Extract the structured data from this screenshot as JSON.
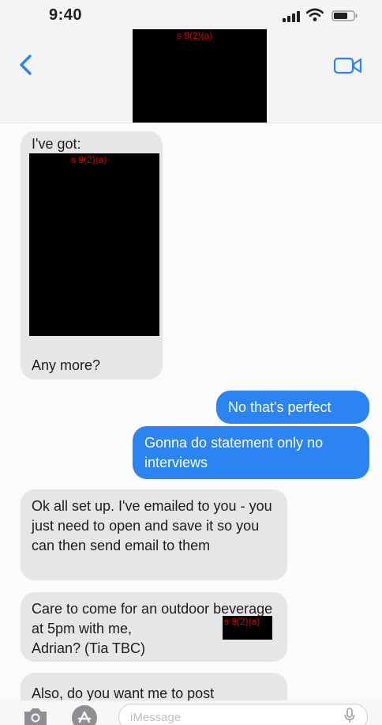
{
  "status_bar": {
    "time": "9:40"
  },
  "header": {
    "contact_redaction_code": "s 9(2)(a)"
  },
  "messages": [
    {
      "direction": "incoming",
      "intro": "I've got:",
      "redaction_code": "s 9(2)(a)",
      "outro": "Any more?"
    },
    {
      "direction": "outgoing",
      "text": "No that's perfect"
    },
    {
      "direction": "outgoing",
      "text": "Gonna do statement only no interviews"
    },
    {
      "direction": "incoming",
      "text": "Ok all set up. I've emailed to you - you just need to open and save it so you can then send email to them"
    },
    {
      "direction": "incoming",
      "text_before_redaction": "Care to come for an outdoor beverage at 5pm with me,",
      "redaction_code": "s 9(2)(a)",
      "text_after_redaction": "Adrian? (Tia TBC)"
    },
    {
      "direction": "incoming",
      "text": "Also, do you want me to post"
    }
  ],
  "input": {
    "placeholder": "iMessage"
  },
  "icons": {
    "back": "chevron-left-icon",
    "video": "video-camera-icon",
    "camera": "camera-icon",
    "apps": "app-store-icon",
    "mic": "microphone-icon"
  },
  "colors": {
    "accent": "#2b84f2",
    "incoming_bubble": "#e6e6e8",
    "redaction": "#000000",
    "redaction_label": "#e00000"
  }
}
